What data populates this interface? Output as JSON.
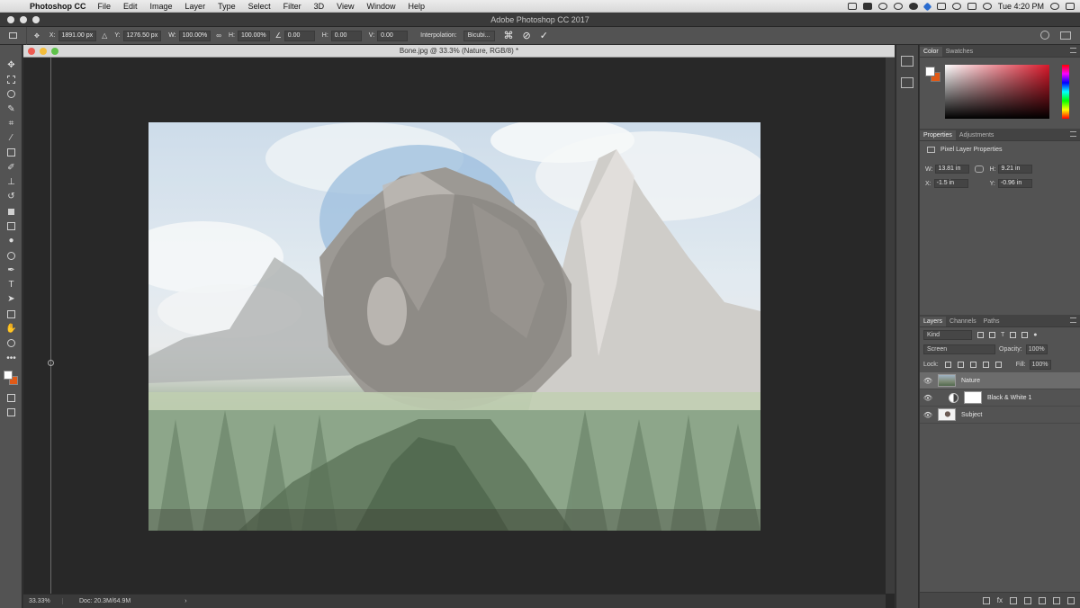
{
  "menubar": {
    "app_name": "Photoshop CC",
    "items": [
      "File",
      "Edit",
      "Image",
      "Layer",
      "Type",
      "Select",
      "Filter",
      "3D",
      "View",
      "Window",
      "Help"
    ],
    "clock": "Tue 4:20 PM"
  },
  "app_title": "Adobe Photoshop CC 2017",
  "options": {
    "x_label": "X:",
    "x_value": "1891.00 px",
    "y_label": "Y:",
    "y_value": "1276.50 px",
    "w_label": "W:",
    "w_value": "100.00%",
    "h_label": "H:",
    "h_value": "100.00%",
    "angle_value": "0.00",
    "hskew_label": "H:",
    "hskew_value": "0.00",
    "vskew_label": "V:",
    "vskew_value": "0.00",
    "interp_label": "Interpolation:",
    "interp_value": "Bicubi..."
  },
  "document": {
    "tab_title": "Bone.jpg @ 33.3% (Nature, RGB/8) *",
    "zoom": "33.33%",
    "doc_size": "Doc: 20.3M/64.9M"
  },
  "color_panel": {
    "tabs": [
      "Color",
      "Swatches"
    ],
    "foreground": "#ffffff",
    "background": "#e05a17"
  },
  "properties_panel": {
    "tabs": [
      "Properties",
      "Adjustments"
    ],
    "title": "Pixel Layer Properties",
    "w_label": "W:",
    "w_value": "13.81 in",
    "h_label": "H:",
    "h_value": "9.21 in",
    "x_label": "X:",
    "x_value": "-1.5 in",
    "y_label": "Y:",
    "y_value": "-0.96 in"
  },
  "layers_panel": {
    "tabs": [
      "Layers",
      "Channels",
      "Paths"
    ],
    "filter": "Kind",
    "blend_mode": "Screen",
    "opacity_label": "Opacity:",
    "opacity_value": "100%",
    "lock_label": "Lock:",
    "fill_label": "Fill:",
    "fill_value": "100%",
    "layers": [
      {
        "name": "Nature",
        "selected": true
      },
      {
        "name": "Black & White 1",
        "selected": false
      },
      {
        "name": "Subject",
        "selected": false
      }
    ]
  }
}
